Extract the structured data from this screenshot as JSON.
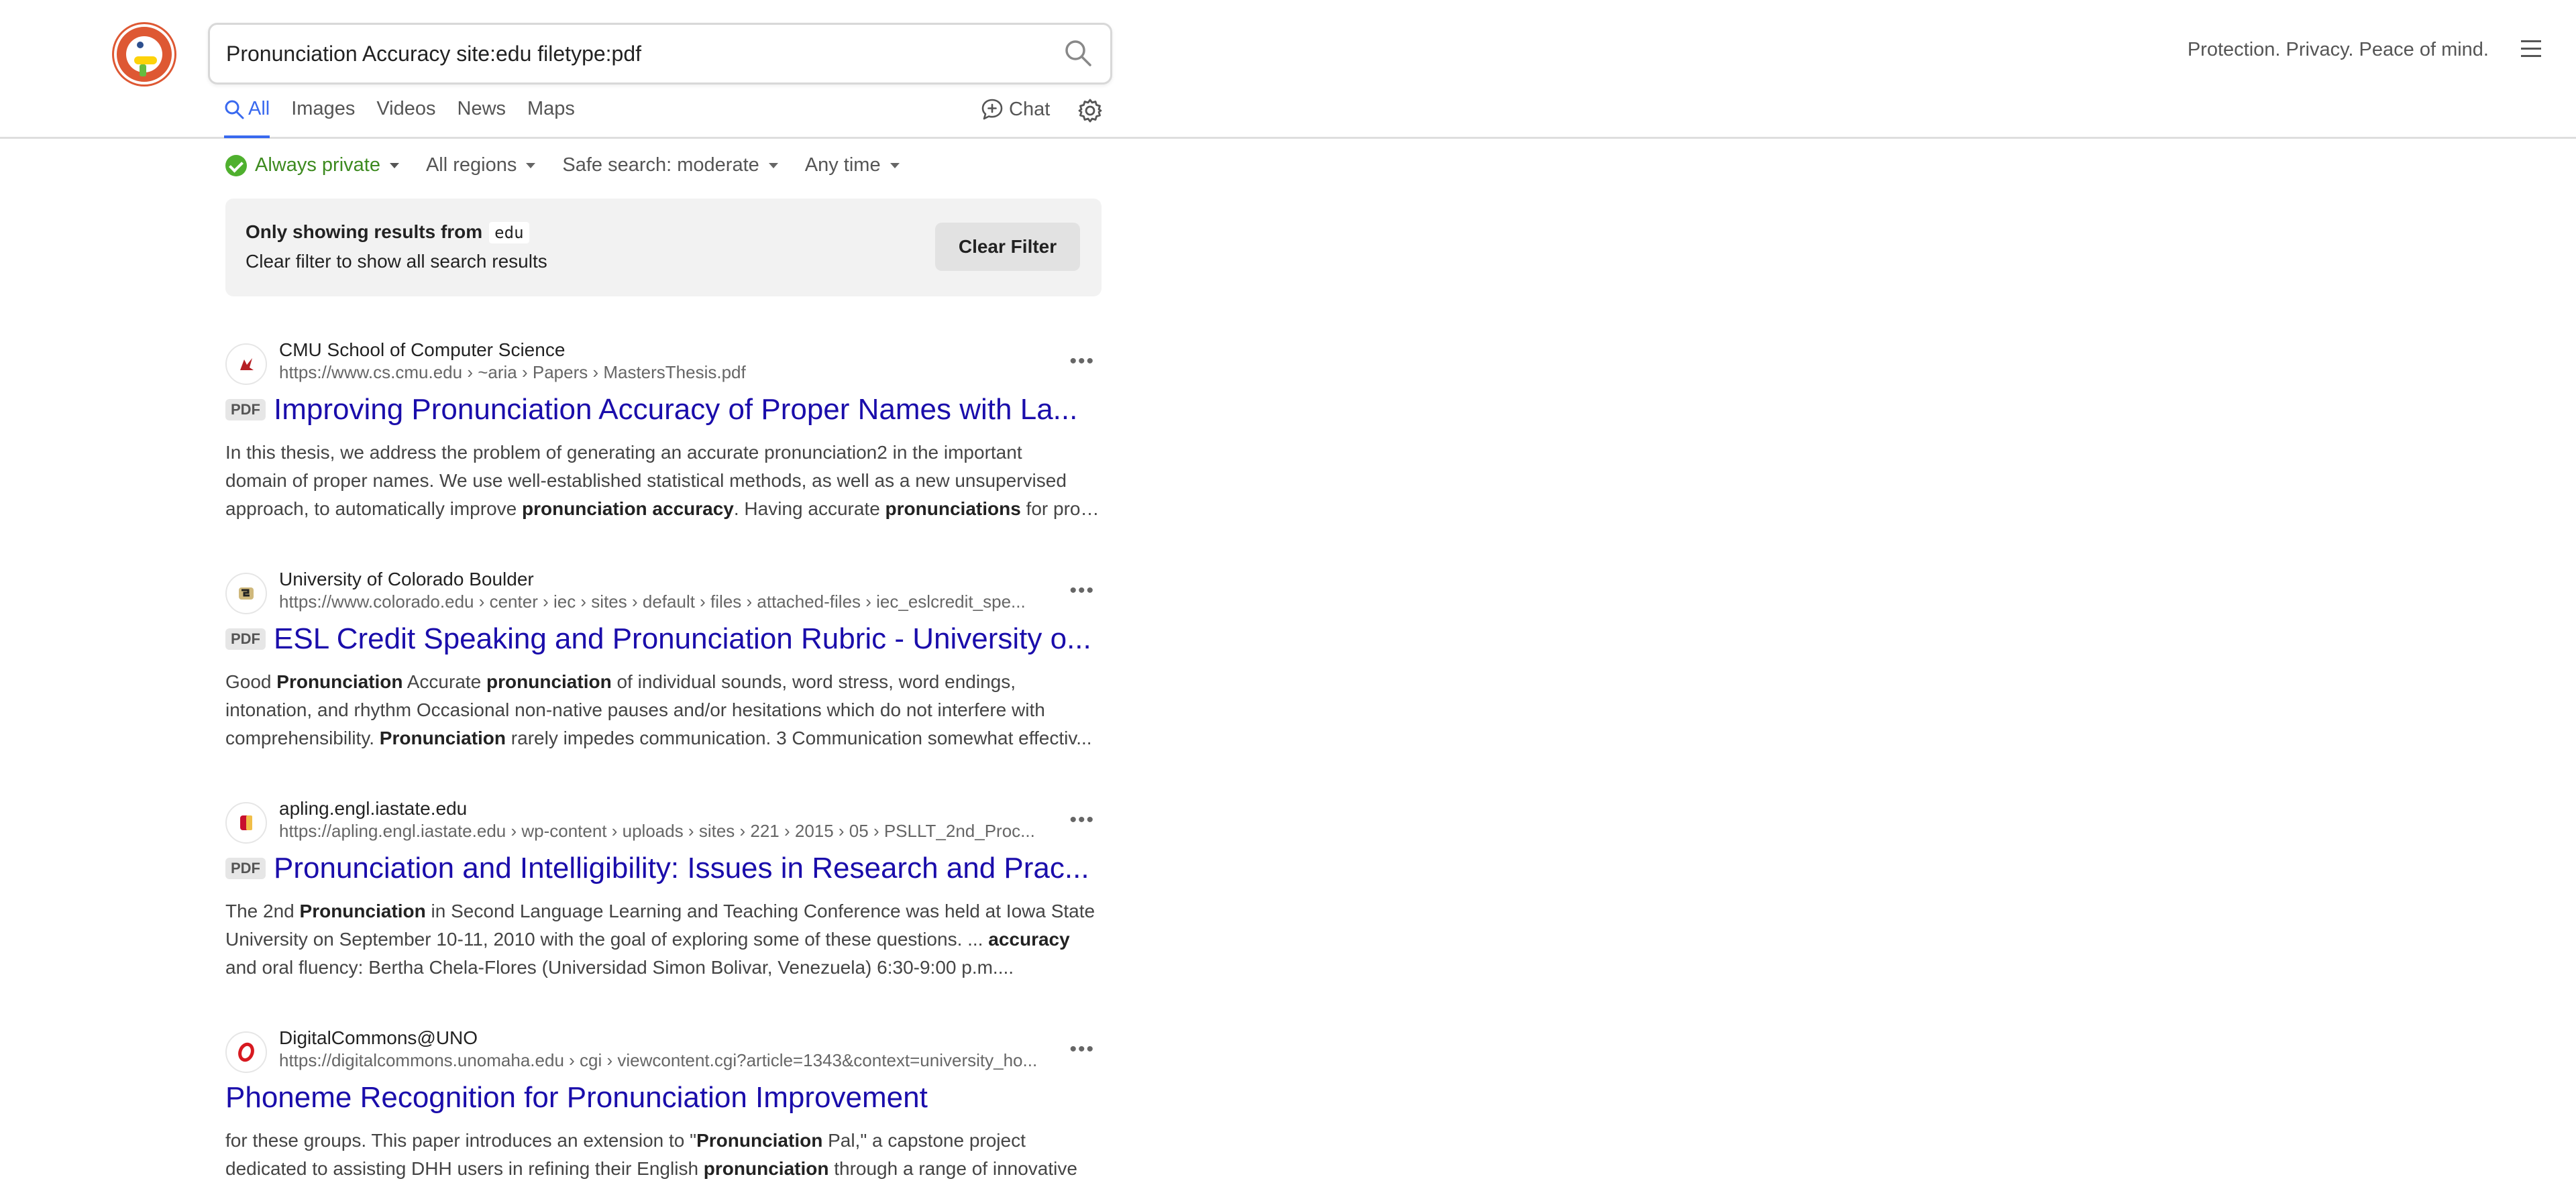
{
  "search": {
    "query": "Pronunciation Accuracy site:edu filetype:pdf"
  },
  "header": {
    "tagline": "Protection. Privacy. Peace of mind."
  },
  "tabs": [
    {
      "label": "All",
      "active": true
    },
    {
      "label": "Images"
    },
    {
      "label": "Videos"
    },
    {
      "label": "News"
    },
    {
      "label": "Maps"
    }
  ],
  "chat_label": "Chat",
  "filters": {
    "privacy": "Always private",
    "region": "All regions",
    "safe_search": "Safe search: moderate",
    "time": "Any time"
  },
  "notice": {
    "line1": "Only showing results from",
    "site": "edu",
    "line2": "Clear filter to show all search results",
    "button": "Clear Filter"
  },
  "results": [
    {
      "site_name": "CMU School of Computer Science",
      "url": "https://www.cs.cmu.edu › ~aria › Papers › MastersThesis.pdf",
      "badge": "PDF",
      "title": "Improving Pronunciation Accuracy of Proper Names with La...",
      "snippet_html": [
        "In this thesis, we address the problem of generating an accurate pronunciation2 in the important",
        "domain of proper names. We use well-established statistical methods, as well as a new unsupervised",
        "approach, to automatically improve <b>pronunciation accuracy</b>. Having accurate <b>pronunciations</b> for prop..."
      ]
    },
    {
      "site_name": "University of Colorado Boulder",
      "url": "https://www.colorado.edu › center › iec › sites › default › files › attached-files › iec_eslcredit_spe...",
      "badge": "PDF",
      "title": "ESL Credit Speaking and Pronunciation Rubric - University o...",
      "snippet_html": [
        "Good <b>Pronunciation</b> Accurate <b>pronunciation</b> of individual sounds, word stress, word endings,",
        "intonation, and rhythm Occasional non-native pauses and/or hesitations which do not interfere with",
        "comprehensibility. <b>Pronunciation</b> rarely impedes communication. 3 Communication somewhat effectiv..."
      ]
    },
    {
      "site_name": "apling.engl.iastate.edu",
      "url": "https://apling.engl.iastate.edu › wp-content › uploads › sites › 221 › 2015 › 05 › PSLLT_2nd_Proc...",
      "badge": "PDF",
      "title": "Pronunciation and Intelligibility: Issues in Research and Prac...",
      "snippet_html": [
        "The 2nd <b>Pronunciation</b> in Second Language Learning and Teaching Conference was held at Iowa State",
        "University on September 10-11, 2010 with the goal of exploring some of these questions. ... <b>accuracy</b>",
        "and oral fluency: Bertha Chela-Flores (Universidad Simon Bolivar, Venezuela) 6:30-9:00 p.m...."
      ]
    },
    {
      "site_name": "DigitalCommons@UNO",
      "url": "https://digitalcommons.unomaha.edu › cgi › viewcontent.cgi?article=1343&context=university_ho...",
      "badge": "",
      "title": "Phoneme Recognition for Pronunciation Improvement",
      "snippet_html": [
        "for these groups. This paper introduces an extension to \"<b>Pronunciation</b> Pal,\" a capstone project",
        "dedicated to assisting DHH users in refining their English <b>pronunciation</b> through a range of innovative"
      ]
    }
  ],
  "colors": {
    "accent": "#3969ef",
    "link": "#1a0dab",
    "private_green": "#3d8a1f",
    "logo_orange": "#de5833"
  }
}
